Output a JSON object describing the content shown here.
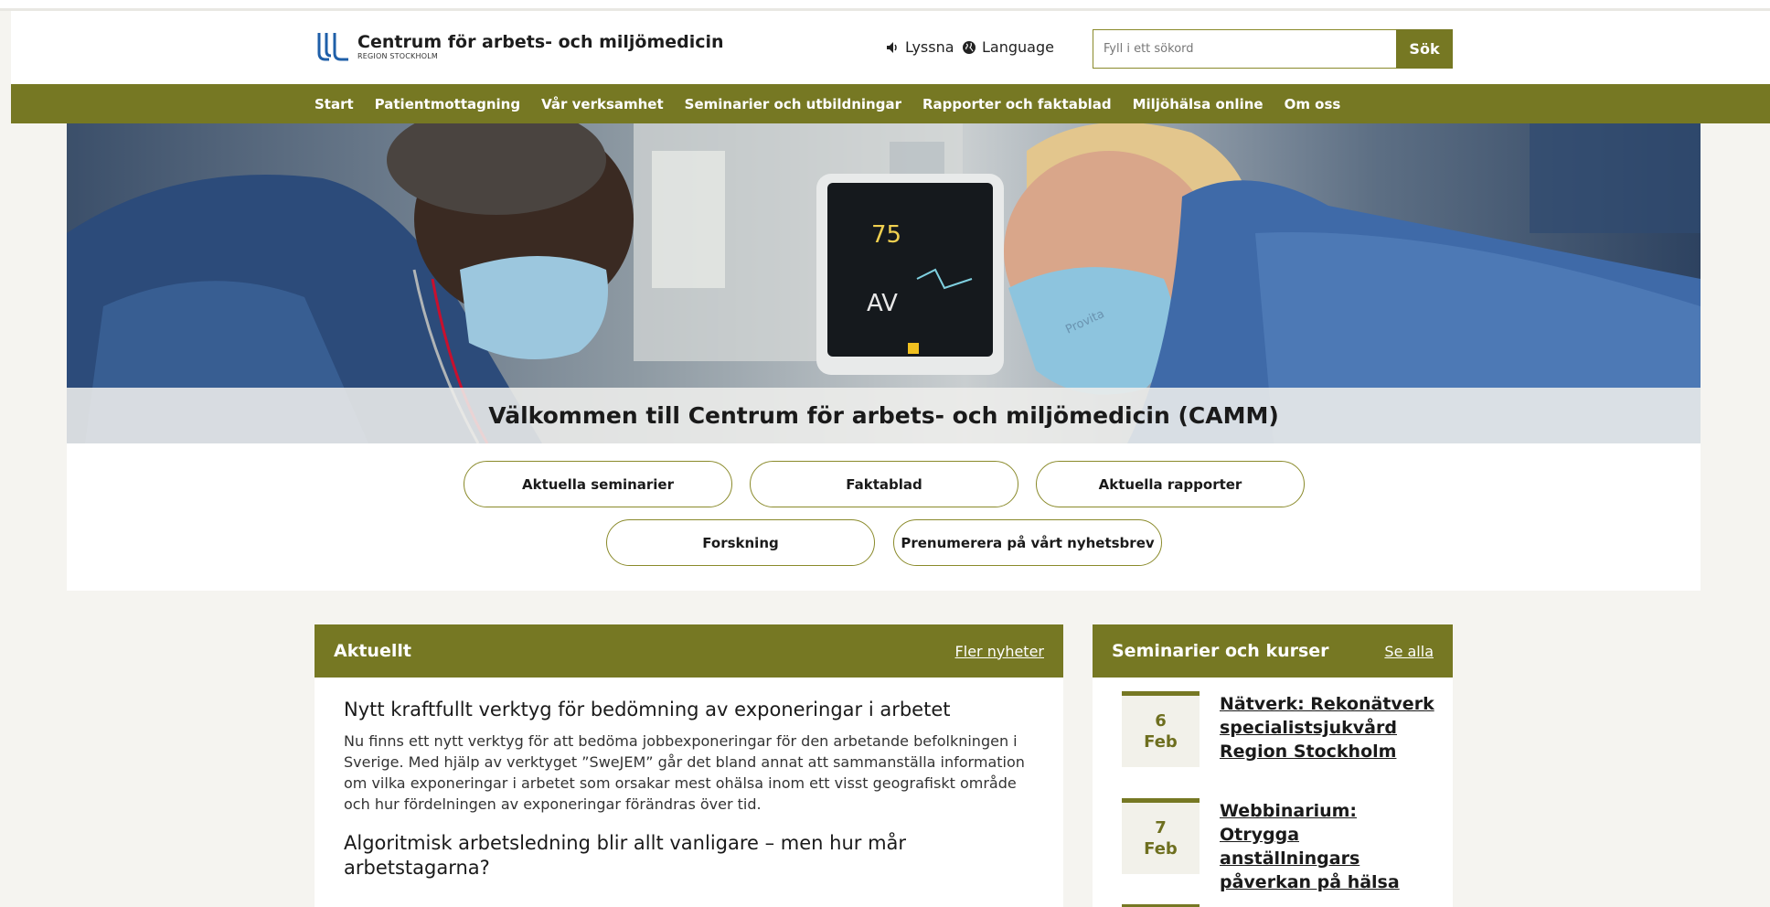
{
  "header": {
    "logo_name": "Centrum för arbets- och miljömedicin",
    "logo_sub": "REGION STOCKHOLM",
    "listen_label": "Lyssna",
    "language_label": "Language",
    "search_placeholder": "Fyll i ett sökord",
    "search_button": "Sök"
  },
  "nav": {
    "items": [
      {
        "label": "Start"
      },
      {
        "label": "Patientmottagning"
      },
      {
        "label": "Vår verksamhet"
      },
      {
        "label": "Seminarier och utbildningar"
      },
      {
        "label": "Rapporter och faktablad"
      },
      {
        "label": "Miljöhälsa online"
      },
      {
        "label": "Om oss"
      }
    ]
  },
  "hero": {
    "title": "Välkommen till Centrum för arbets- och miljömedicin (CAMM)",
    "monitor_value": "75",
    "monitor_label": "AV",
    "mask_text": "Provita"
  },
  "quicklinks": [
    {
      "label": "Aktuella seminarier"
    },
    {
      "label": "Faktablad"
    },
    {
      "label": "Aktuella rapporter"
    },
    {
      "label": "Forskning"
    },
    {
      "label": "Prenumerera på vårt nyhetsbrev"
    }
  ],
  "news": {
    "heading": "Aktuellt",
    "more_link": "Fler nyheter",
    "items": [
      {
        "title": "Nytt kraftfullt verktyg för bedömning av exponeringar i arbetet",
        "text": "Nu finns ett nytt verktyg för att bedöma jobbexponeringar för den arbetande befolkningen i Sverige. Med hjälp av verktyget ”SweJEM” går det bland annat att sammanställa information om vilka exponeringar i arbetet som orsakar mest ohälsa inom ett visst geografiskt område och hur fördelningen av exponeringar förändras över tid."
      },
      {
        "title": "Algoritmisk arbetsledning blir allt vanligare – men hur mår arbetstagarna?",
        "text": ""
      }
    ]
  },
  "seminars": {
    "heading": "Seminarier och kurser",
    "see_all": "Se alla",
    "items": [
      {
        "day": "6",
        "month": "Feb",
        "title": "Nätverk: Rekonätverk specialistsjukvård Region Stockholm"
      },
      {
        "day": "7",
        "month": "Feb",
        "title": "Webbinarium: Otrygga anställningars påverkan på hälsa"
      }
    ]
  },
  "colors": {
    "brand_olive": "#767823",
    "logo_blue": "#1f5fa8",
    "page_bg": "#f5f4f0"
  }
}
